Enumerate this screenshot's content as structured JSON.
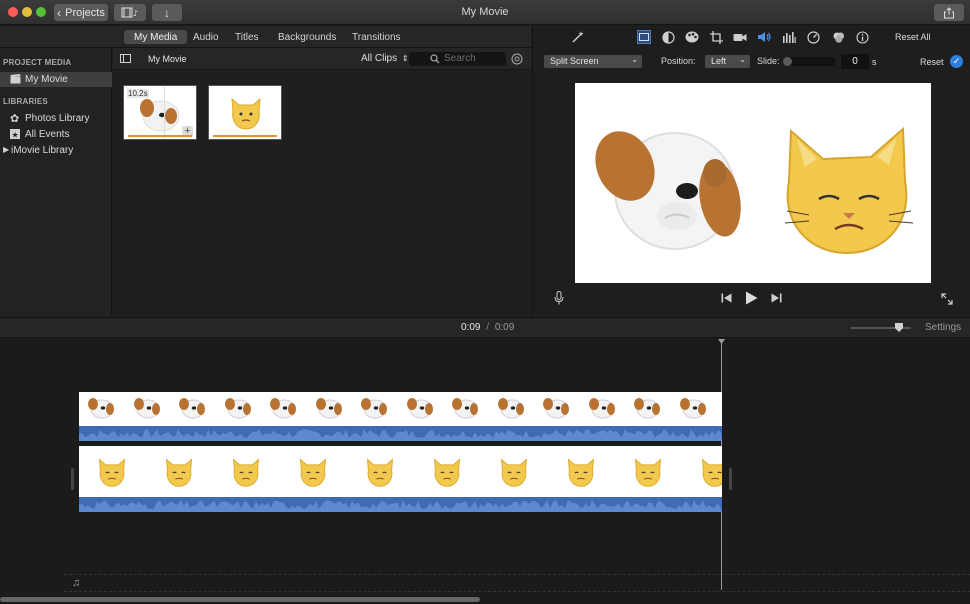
{
  "window": {
    "title": "My Movie",
    "projects_label": "Projects",
    "traffic": [
      "#fc5b57",
      "#e5bf3c",
      "#57c038"
    ]
  },
  "top_tabs": [
    {
      "label": "My Media",
      "active": true
    },
    {
      "label": "Audio",
      "active": false
    },
    {
      "label": "Titles",
      "active": false
    },
    {
      "label": "Backgrounds",
      "active": false
    },
    {
      "label": "Transitions",
      "active": false
    }
  ],
  "sidebar": {
    "project_media_header": "PROJECT MEDIA",
    "project_item": "My Movie",
    "libraries_header": "LIBRARIES",
    "library_items": [
      "Photos Library",
      "All Events",
      "iMovie Library"
    ]
  },
  "browser": {
    "title": "My Movie",
    "filter": "All Clips",
    "search_placeholder": "Search",
    "clips": [
      {
        "duration_badge": "10.2s",
        "icon": "dog-animoji-icon"
      },
      {
        "icon": "cat-animoji-icon"
      }
    ]
  },
  "viewer": {
    "reset_all_label": "Reset All",
    "toolbar_icons": [
      "magic-wand-icon",
      "color-balance-icon",
      "color-correction-icon",
      "crop-icon",
      "stabilization-icon",
      "volume-icon",
      "equalizer-icon",
      "speed-icon",
      "noise-reduction-icon",
      "info-icon"
    ],
    "overlay_select": "Split Screen",
    "position_label": "Position:",
    "position_value": "Left",
    "slide_label": "Slide:",
    "slide_value": "0",
    "slide_unit": "s",
    "reset_label": "Reset"
  },
  "timeline": {
    "current_time": "0:09",
    "separator": "/",
    "total_time": "0:09",
    "settings_label": "Settings"
  },
  "colors": {
    "accent_blue": "#2f7fe0",
    "clip_orange": "#e8902f",
    "waveform_blue": "#3f6bb5",
    "animoji_cat": "#f2c94c",
    "animoji_dog_ear": "#b87333"
  }
}
